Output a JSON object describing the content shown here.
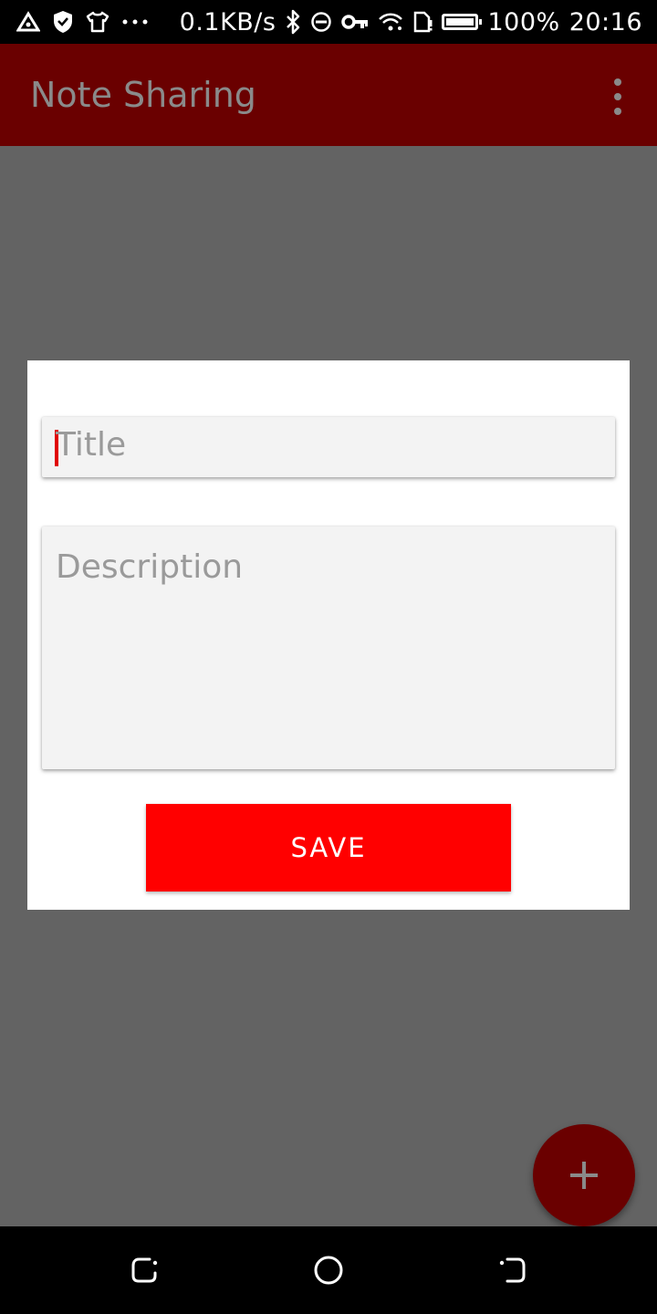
{
  "status_bar": {
    "net_speed": "0.1KB/s",
    "battery_level": "100%",
    "time": "20:16",
    "icons": [
      "triangle-icon",
      "shield-icon",
      "shirt-icon",
      "more-dots-icon",
      "bluetooth-icon",
      "do-not-disturb-icon",
      "vpn-key-icon",
      "wifi-icon",
      "no-sim-icon",
      "battery-icon"
    ]
  },
  "app_bar": {
    "title": "Note Sharing",
    "overflow_icon": "overflow-menu-icon"
  },
  "dialog": {
    "title_placeholder": "Title",
    "description_placeholder": "Description",
    "save_label": "SAVE"
  },
  "fab": {
    "icon": "plus-icon"
  },
  "nav_bar": {
    "icons": [
      "back-icon",
      "home-icon",
      "recent-apps-icon"
    ]
  },
  "colors": {
    "app_bar": "#6a0000",
    "accent": "#ff0000",
    "scrim": "#636363",
    "field_bg": "#f3f3f3",
    "placeholder_text": "#9a9a9a"
  }
}
